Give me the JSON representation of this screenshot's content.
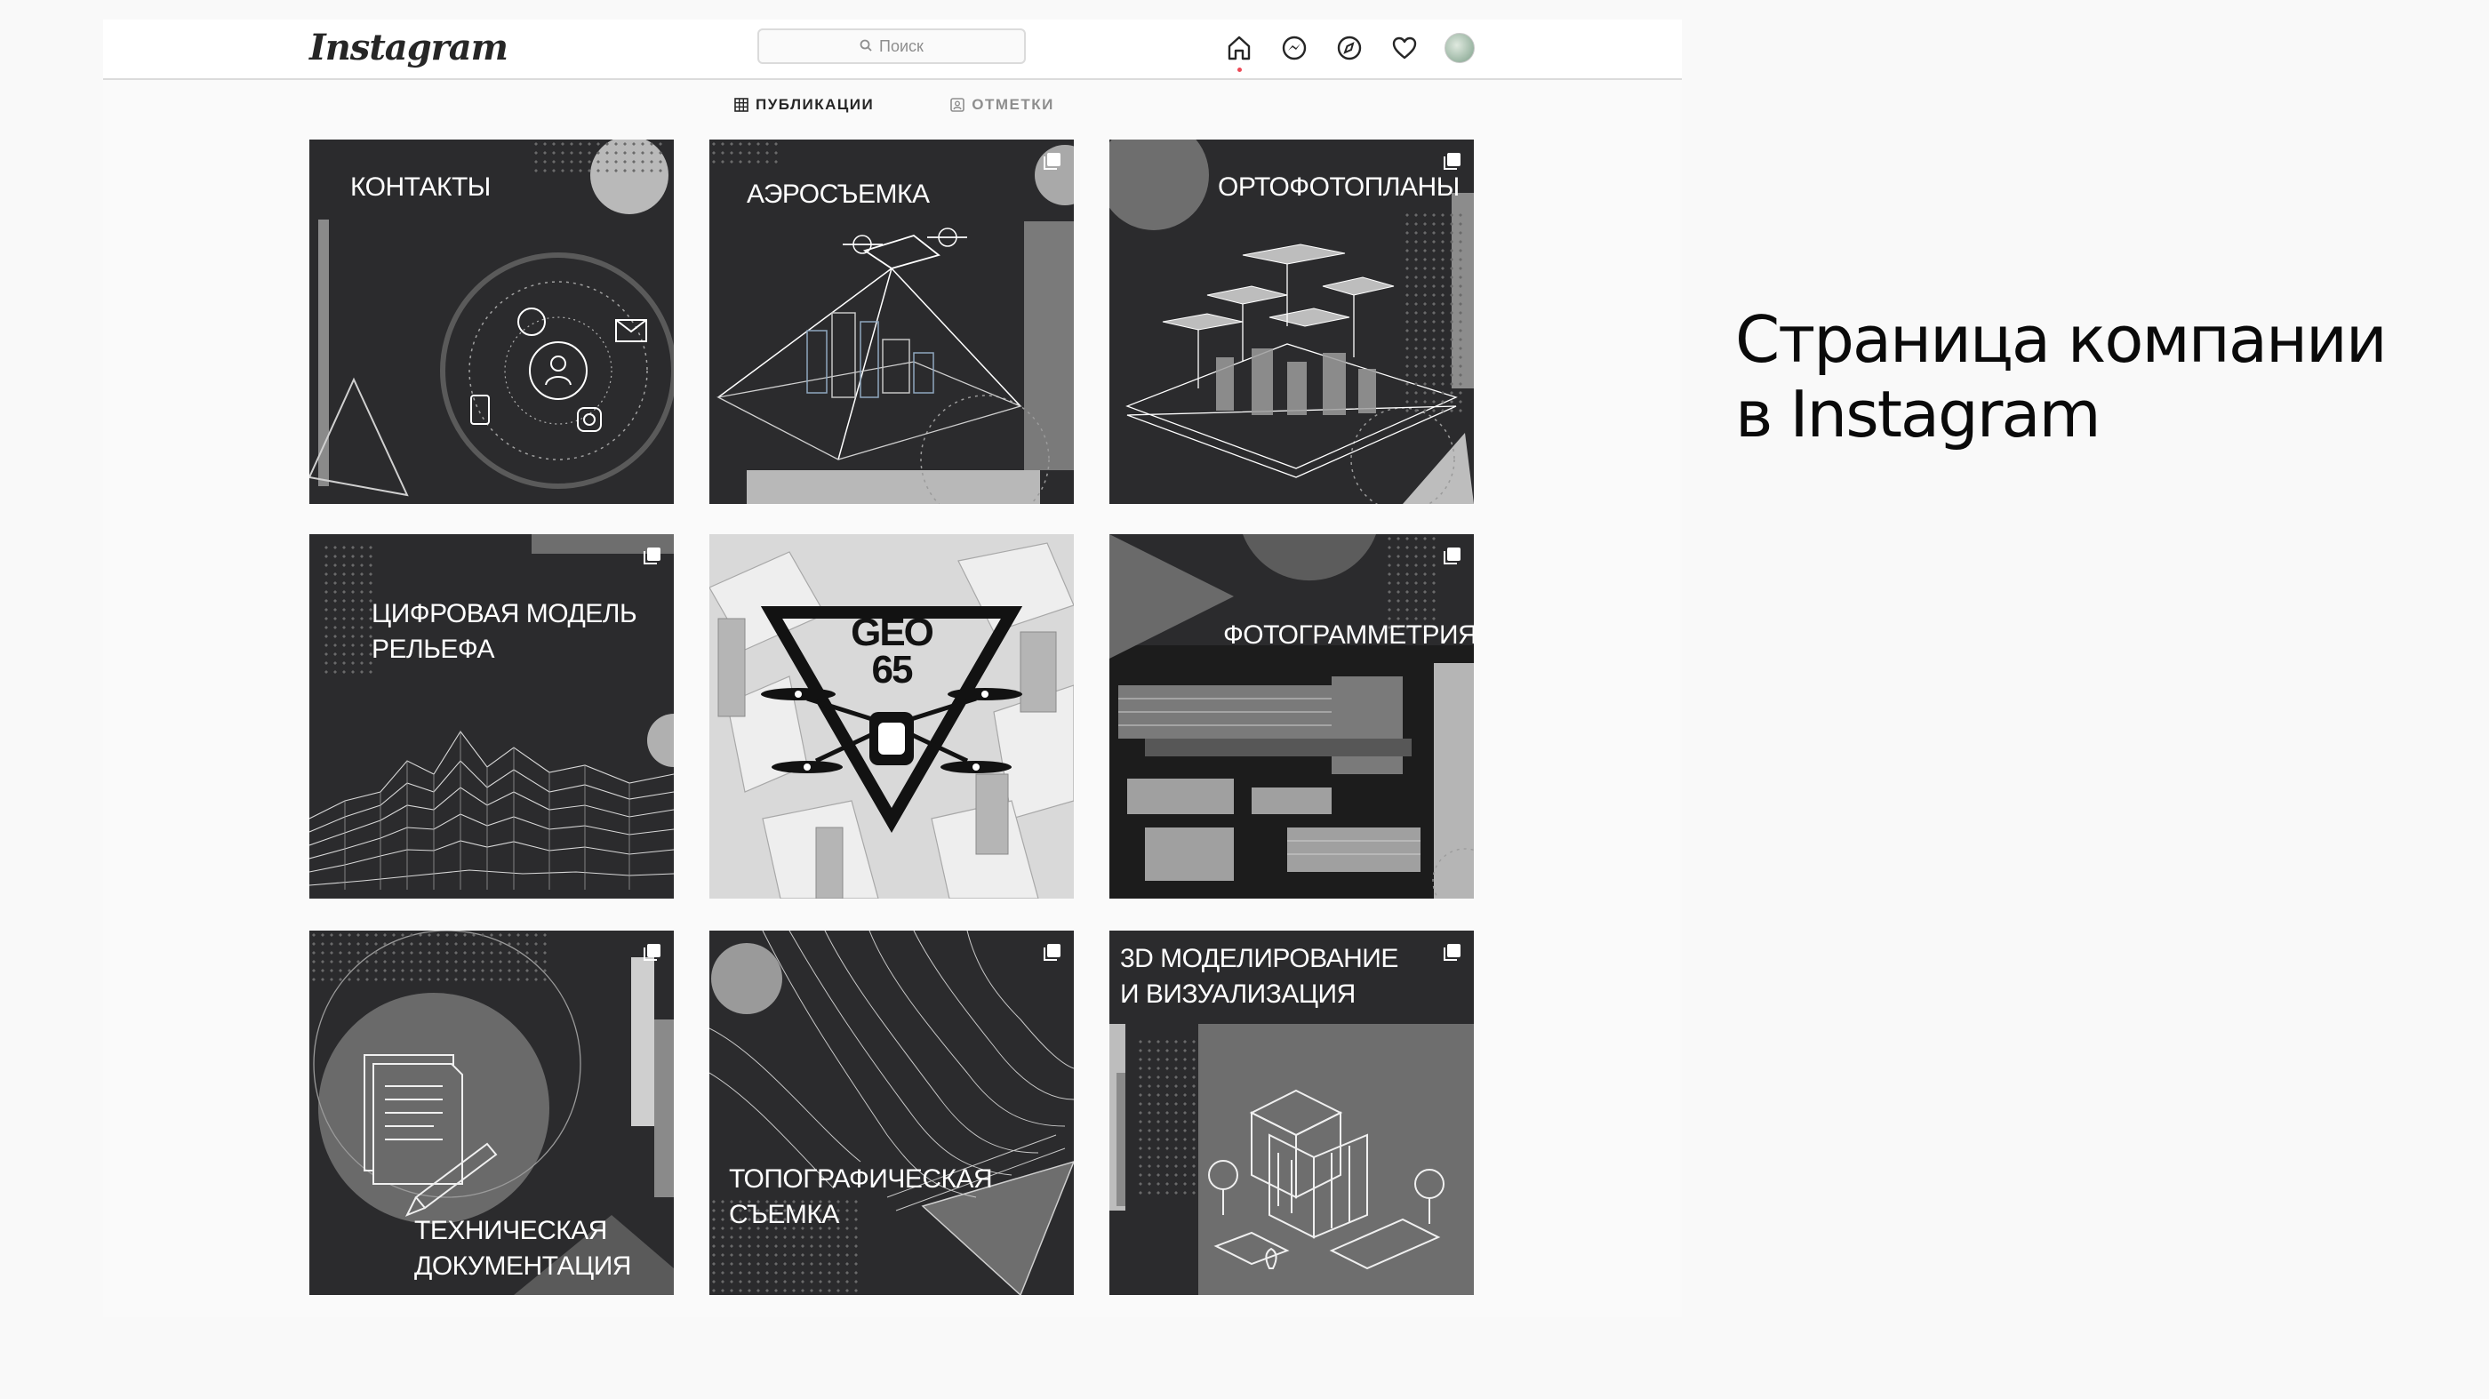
{
  "app": {
    "logo": "Instagram",
    "search": {
      "placeholder": "Поиск",
      "icon": "search-icon"
    },
    "nav_icons": [
      "home-icon",
      "messenger-icon",
      "explore-icon",
      "heart-icon",
      "avatar"
    ]
  },
  "tabs": [
    {
      "label": "ПУБЛИКАЦИИ",
      "icon": "grid-icon",
      "active": true
    },
    {
      "label": "ОТМЕТКИ",
      "icon": "tagged-icon",
      "active": false
    }
  ],
  "posts": [
    {
      "label": "КОНТАКТЫ",
      "multi": false
    },
    {
      "label": "АЭРОСЪЕМКА",
      "multi": true
    },
    {
      "label": "ОРТОФОТОПЛАНЫ",
      "multi": true
    },
    {
      "label": "ЦИФРОВАЯ МОДЕЛЬ\nРЕЛЬЕФА",
      "multi": true
    },
    {
      "label": "GEO\n65",
      "multi": false
    },
    {
      "label": "ФОТОГРАММЕТРИЯ",
      "multi": true
    },
    {
      "label": "ТЕХНИЧЕСКАЯ\nДОКУМЕНТАЦИЯ",
      "multi": true
    },
    {
      "label": "ТОПОГРАФИЧЕСКАЯ\nСЪЕМКА",
      "multi": true
    },
    {
      "label": "3D МОДЕЛИРОВАНИЕ\nИ ВИЗУАЛИЗАЦИЯ",
      "multi": true
    }
  ],
  "caption": "Страница компании\nв Instagram",
  "colors": {
    "tile_bg": "#2b2b2d",
    "accent_dot": "#ed4956",
    "text": "#262626"
  }
}
